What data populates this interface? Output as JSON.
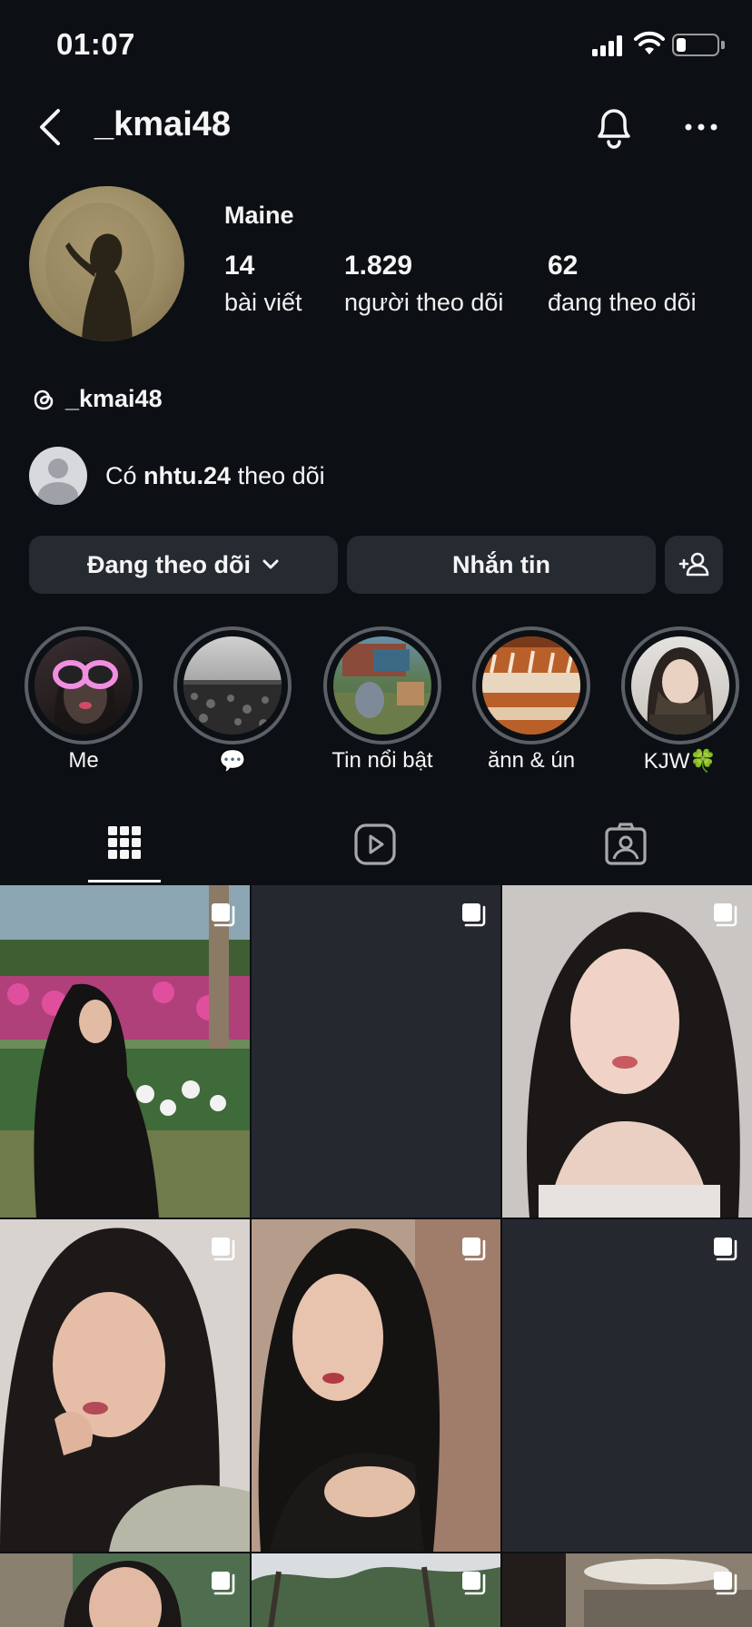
{
  "status_bar": {
    "time": "01:07",
    "battery_level": 0.22
  },
  "header": {
    "username": "_kmai48"
  },
  "profile": {
    "display_name": "Maine",
    "stats": [
      {
        "value": "14",
        "label": "bài viết"
      },
      {
        "value": "1.829",
        "label": "người theo dõi"
      },
      {
        "value": "62",
        "label": "đang theo dõi"
      }
    ],
    "threads_handle": "_kmai48",
    "followed_by": {
      "prefix": "Có",
      "name": "nhtu.24",
      "suffix": "theo dõi"
    }
  },
  "actions": {
    "following": "Đang theo dõi",
    "message": "Nhắn tin"
  },
  "highlights": [
    {
      "label": "Me"
    },
    {
      "label": "💬"
    },
    {
      "label": "Tin nổi bật"
    },
    {
      "label": "ănn & ún"
    },
    {
      "label": "KJW🍀"
    }
  ],
  "tabs": [
    {
      "icon": "grid-icon",
      "active": true
    },
    {
      "icon": "reels-icon",
      "active": false
    },
    {
      "icon": "tagged-icon",
      "active": false
    }
  ],
  "colors": {
    "background": "#0c1014",
    "button": "#262a31",
    "text": "#f5f5f5"
  }
}
